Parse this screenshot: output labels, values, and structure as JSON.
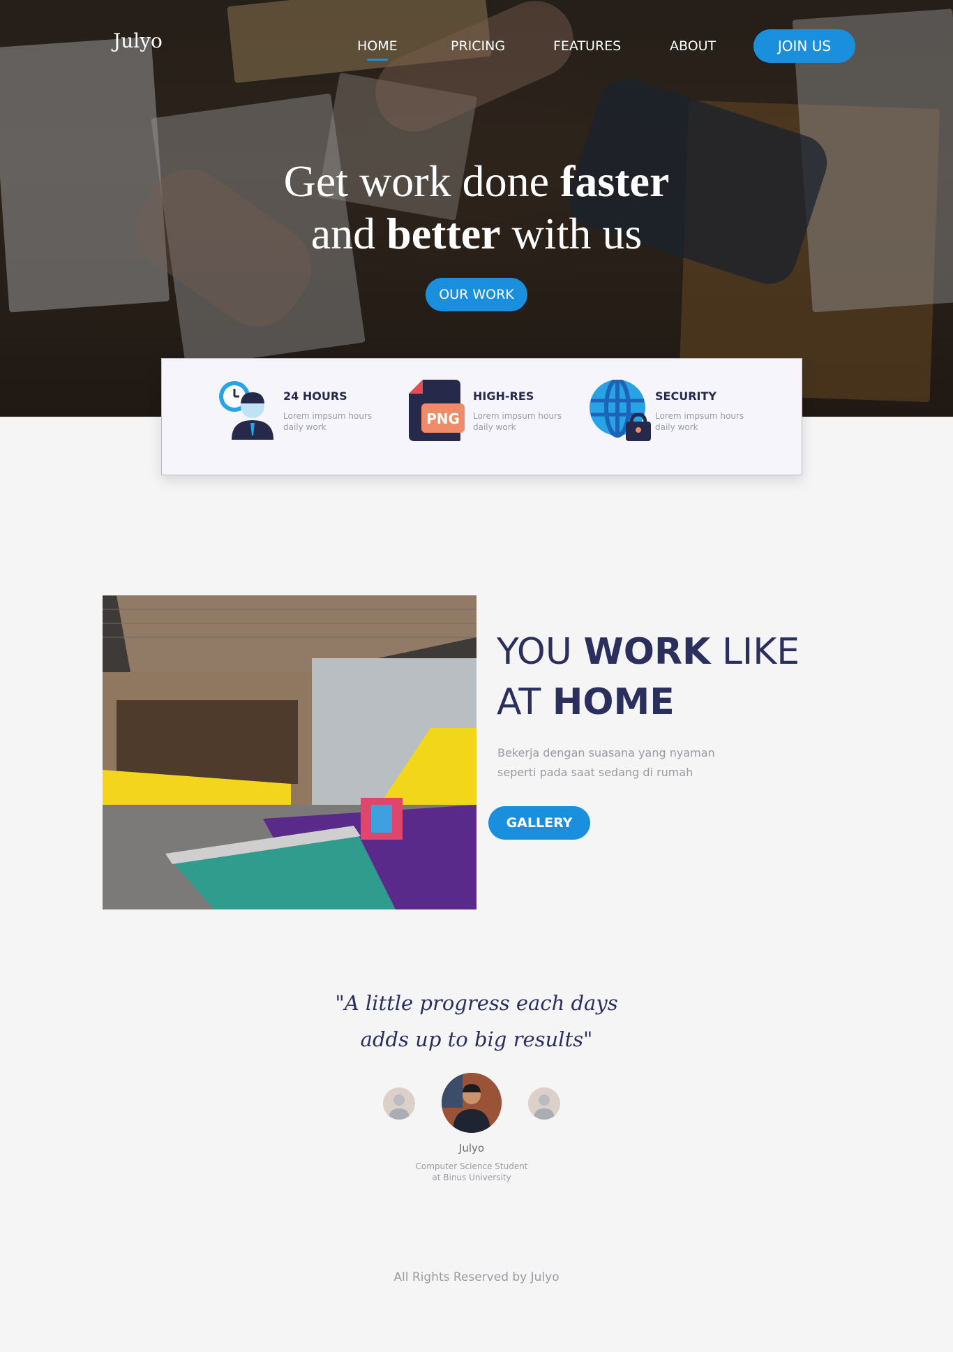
{
  "brand": {
    "logo": "Julyo",
    "accent": "#1a8fde",
    "navy": "#2b2f5e"
  },
  "nav": {
    "items": [
      {
        "label": "HOME",
        "active": true
      },
      {
        "label": "PRICING",
        "active": false
      },
      {
        "label": "FEATURES",
        "active": false
      },
      {
        "label": "ABOUT",
        "active": false
      }
    ],
    "cta": "JOIN US"
  },
  "hero": {
    "line1_pre": "Get work done ",
    "line1_bold": "faster",
    "line2_pre": "and ",
    "line2_bold": "better",
    "line2_post": " with us",
    "button": "OUR WORK"
  },
  "features": [
    {
      "title": "24 HOURS",
      "desc": "Lorem impsum hours daily work",
      "icon": "clock-support-icon"
    },
    {
      "title": "HIGH-RES",
      "desc": "Lorem impsum hours daily work",
      "icon": "png-file-icon",
      "icon_text": "PNG"
    },
    {
      "title": "SECURITY",
      "desc": "Lorem impsum hours daily work",
      "icon": "globe-lock-icon"
    }
  ],
  "about": {
    "title_pre": "YOU ",
    "title_bold1": "WORK",
    "title_mid": " LIKE",
    "title_pre2": "AT ",
    "title_bold2": "HOME",
    "desc": "Bekerja dengan suasana yang nyaman seperti pada saat sedang di rumah",
    "button": "GALLERY"
  },
  "testimonial": {
    "quote_line1": "\"A little progress each days",
    "quote_line2": "adds up to big results\"",
    "name": "Julyo",
    "role_line1": "Computer Science Student",
    "role_line2": "at Binus University"
  },
  "footer": {
    "text": "All Rights Reserved by Julyo"
  }
}
